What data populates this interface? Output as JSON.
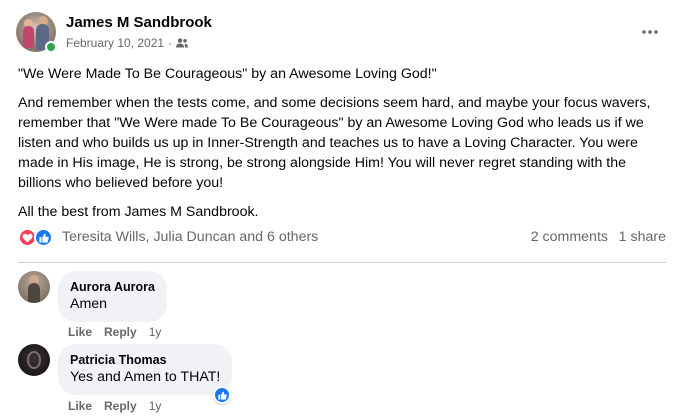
{
  "post": {
    "author_name": "James M Sandbrook",
    "date": "February 10, 2021",
    "separator": "·",
    "audience_icon": "friends-icon",
    "paragraphs": [
      "\"We Were Made To Be Courageous\" by an Awesome Loving God!\"",
      "And remember when the tests come, and some decisions seem hard, and maybe your focus wavers, remember that \"We Were made To Be Courageous\" by an Awesome Loving God who leads us if we listen and who builds us up in Inner-Strength and teaches us to have a Loving Character. You were made in His image, He is strong, be strong alongside Him! You will never regret standing with the billions who believed before you!",
      "All the best from James M Sandbrook."
    ]
  },
  "reactions": {
    "icons": [
      "love-reaction-icon",
      "like-reaction-icon"
    ],
    "names_text": "Teresita Wills, Julia Duncan and 6 others",
    "comments_text": "2 comments",
    "shares_text": "1 share"
  },
  "comments": [
    {
      "name": "Aurora Aurora",
      "text": "Amen",
      "like_label": "Like",
      "reply_label": "Reply",
      "age": "1y"
    },
    {
      "name": "Patricia Thomas",
      "text": "Yes and Amen to THAT!",
      "like_label": "Like",
      "reply_label": "Reply",
      "age": "1y",
      "reaction_icon": "like-reaction-icon"
    }
  ],
  "colors": {
    "text_primary": "#050505",
    "text_secondary": "#65676b",
    "bubble_bg": "#f0f2f5",
    "like_blue": "#1877f2",
    "love_red": "#f33e58",
    "online_green": "#31a24c"
  }
}
